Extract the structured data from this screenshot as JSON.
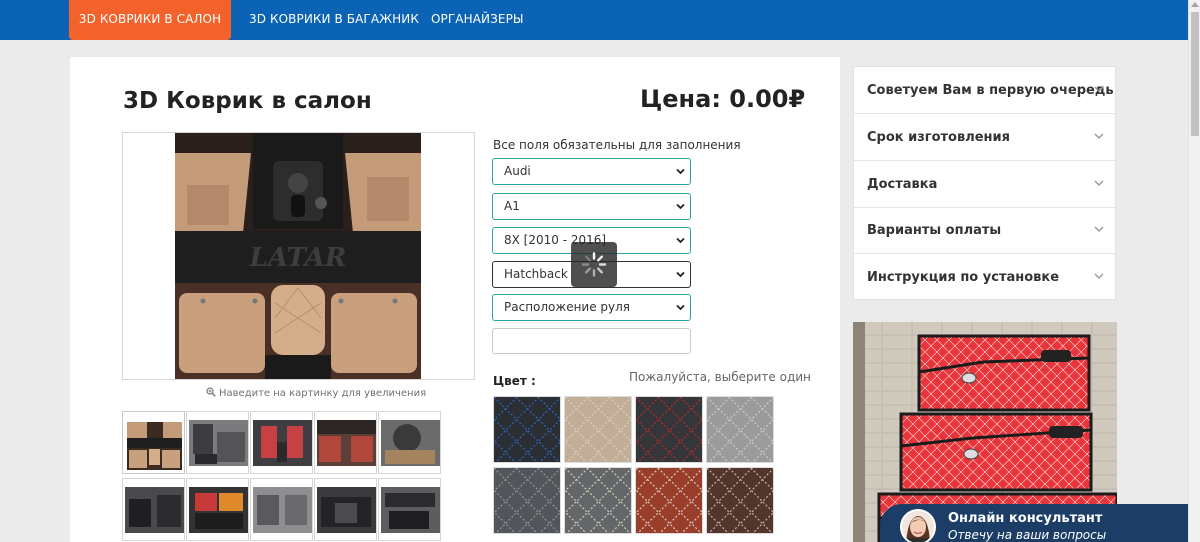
{
  "nav": {
    "items": [
      {
        "label": "3D коврики в салон",
        "active": true
      },
      {
        "label": "3D коврики в багажник",
        "active": false
      },
      {
        "label": "Органайзеры",
        "active": false
      }
    ]
  },
  "product": {
    "title": "3D Коврик в салон",
    "price_label": "Цена: 0.00",
    "currency_symbol": "₽",
    "zoom_hint": "Наведите на картинку для увеличения"
  },
  "form": {
    "required_note": "Все поля обязательны для заполнения",
    "selects": [
      {
        "name": "brand",
        "value": "Audi"
      },
      {
        "name": "model",
        "value": "A1"
      },
      {
        "name": "generation",
        "value": "8X [2010 - 2016]"
      },
      {
        "name": "body",
        "value": "Hatchback"
      },
      {
        "name": "steering",
        "value": "Расположение руля"
      }
    ],
    "text_input_value": "",
    "color_label": "Цвет :",
    "color_hint": "Пожалуйста, выберите один"
  },
  "swatches": [
    {
      "name": "black-blue-stitch",
      "base": "#2f3237",
      "stitch": "#2f6fd6"
    },
    {
      "name": "beige",
      "base": "#d3bca3",
      "stitch": "#efe2d2"
    },
    {
      "name": "black-red-stitch",
      "base": "#3a3b3f",
      "stitch": "#c92f2f"
    },
    {
      "name": "grey",
      "base": "#a9a9aa",
      "stitch": "#dcdcdc"
    },
    {
      "name": "dark-grey",
      "base": "#5a5e63",
      "stitch": "#9ea2a6"
    },
    {
      "name": "grey-beige-stitch",
      "base": "#6d7073",
      "stitch": "#e6dcc6"
    },
    {
      "name": "terracotta",
      "base": "#a6442f",
      "stitch": "#f2dcd1"
    },
    {
      "name": "brown",
      "base": "#5a3a30",
      "stitch": "#d8c1b3"
    }
  ],
  "sidebar": {
    "items": [
      {
        "label": "Советуем Вам в первую очередь"
      },
      {
        "label": "Срок изготовления"
      },
      {
        "label": "Доставка"
      },
      {
        "label": "Варианты оплаты"
      },
      {
        "label": "Инструкция по установке"
      }
    ]
  },
  "chat": {
    "title": "Онлайн консультант",
    "subtitle": "Отвечу на ваши вопросы"
  },
  "colors": {
    "nav_bg": "#0b63b5",
    "nav_active": "#f4622c",
    "field_border": "#2aa6a6",
    "chat_bg": "#1b3d66"
  },
  "icons": {
    "select_arrow": "chevron-down-icon",
    "accordion_arrow": "chevron-down-icon",
    "zoom": "magnifier-icon"
  }
}
